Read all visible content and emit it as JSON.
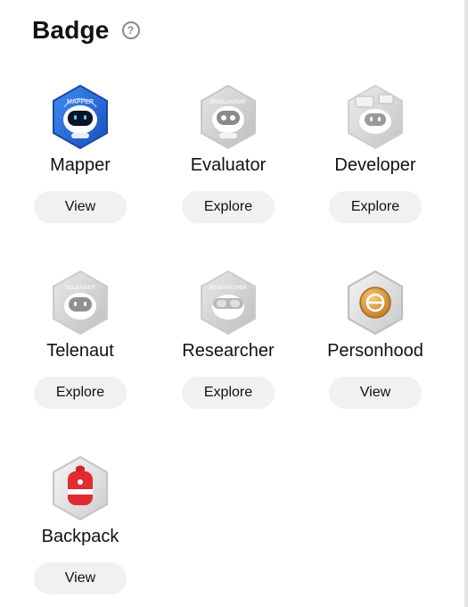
{
  "header": {
    "title": "Badge",
    "help_symbol": "?"
  },
  "badges": [
    {
      "name": "Mapper",
      "button": "View",
      "icon": "mapper-badge-icon",
      "status": "earned",
      "ring_text": "MAPPER",
      "accent": "#1f5fd6"
    },
    {
      "name": "Evaluator",
      "button": "Explore",
      "icon": "evaluator-badge-icon",
      "status": "locked",
      "ring_text": "EVALUATOR"
    },
    {
      "name": "Developer",
      "button": "Explore",
      "icon": "developer-badge-icon",
      "status": "locked"
    },
    {
      "name": "Telenaut",
      "button": "Explore",
      "icon": "telenaut-badge-icon",
      "status": "locked",
      "ring_text": "TELENAUT"
    },
    {
      "name": "Researcher",
      "button": "Explore",
      "icon": "researcher-badge-icon",
      "status": "locked",
      "ring_text": "RESEARCHER"
    },
    {
      "name": "Personhood",
      "button": "View",
      "icon": "personhood-badge-icon",
      "status": "earned",
      "accent": "#d9902f"
    },
    {
      "name": "Backpack",
      "button": "View",
      "icon": "backpack-badge-icon",
      "status": "earned",
      "accent": "#d4242a"
    }
  ]
}
